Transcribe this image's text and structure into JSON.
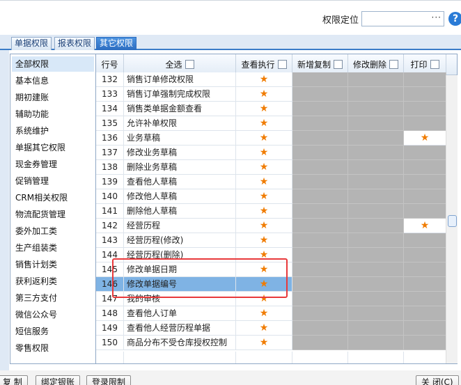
{
  "header": {
    "locate_label": "权限定位",
    "locate_value": "",
    "locate_button": "···",
    "help": "?"
  },
  "tabs": [
    {
      "label": "单据权限",
      "active": false
    },
    {
      "label": "报表权限",
      "active": false
    },
    {
      "label": "其它权限",
      "active": true
    }
  ],
  "sidebar": {
    "items": [
      {
        "label": "全部权限",
        "selected": true
      },
      {
        "label": "基本信息"
      },
      {
        "label": "期初建账"
      },
      {
        "label": "辅助功能"
      },
      {
        "label": "系统维护"
      },
      {
        "label": "单据其它权限"
      },
      {
        "label": "现金券管理"
      },
      {
        "label": "促销管理"
      },
      {
        "label": "CRM相关权限"
      },
      {
        "label": "物流配货管理"
      },
      {
        "label": "委外加工类"
      },
      {
        "label": "生产组装类"
      },
      {
        "label": "销售计划类"
      },
      {
        "label": "获利返利类"
      },
      {
        "label": "第三方支付"
      },
      {
        "label": "微信公众号"
      },
      {
        "label": "短信服务"
      },
      {
        "label": "零售权限"
      }
    ]
  },
  "grid": {
    "columns": {
      "row_no": "行号",
      "select_all": "全选",
      "view_exec": "查看执行",
      "add_copy": "新增复制",
      "edit_delete": "修改删除",
      "print": "打印"
    },
    "star_symbol": "★",
    "rows": [
      {
        "no": "132",
        "name": "销售订单修改权限",
        "view": true,
        "print": "grey"
      },
      {
        "no": "133",
        "name": "销售订单强制完成权限",
        "view": true,
        "print": "grey"
      },
      {
        "no": "134",
        "name": "销售类单据金额查看",
        "view": true,
        "print": "grey"
      },
      {
        "no": "135",
        "name": "允许补单权限",
        "view": true,
        "print": "grey"
      },
      {
        "no": "136",
        "name": "业务草稿",
        "view": true,
        "print": "star"
      },
      {
        "no": "137",
        "name": "修改业务草稿",
        "view": true,
        "print": "grey"
      },
      {
        "no": "138",
        "name": "删除业务草稿",
        "view": true,
        "print": "grey"
      },
      {
        "no": "139",
        "name": "查看他人草稿",
        "view": true,
        "print": "grey"
      },
      {
        "no": "140",
        "name": "修改他人草稿",
        "view": true,
        "print": "grey"
      },
      {
        "no": "141",
        "name": "删除他人草稿",
        "view": true,
        "print": "grey"
      },
      {
        "no": "142",
        "name": "经营历程",
        "view": true,
        "print": "star"
      },
      {
        "no": "143",
        "name": "经营历程(修改)",
        "view": true,
        "print": "grey"
      },
      {
        "no": "144",
        "name": "经营历程(删除)",
        "view": true,
        "print": "grey"
      },
      {
        "no": "145",
        "name": "修改单据日期",
        "view": true,
        "print": "grey"
      },
      {
        "no": "146",
        "name": "修改单据编号",
        "view": true,
        "print": "grey",
        "selected": true
      },
      {
        "no": "147",
        "name": "我的审核",
        "view": true,
        "print": "grey"
      },
      {
        "no": "148",
        "name": "查看他人订单",
        "view": true,
        "print": "grey"
      },
      {
        "no": "149",
        "name": "查看他人经营历程单据",
        "view": true,
        "print": "grey"
      },
      {
        "no": "150",
        "name": "商品分布不受仓库授权控制",
        "view": true,
        "print": "grey"
      }
    ]
  },
  "footer": {
    "buttons": [
      "复 制",
      "绑定银账",
      "登录限制"
    ],
    "close": "关 闭(C)"
  }
}
